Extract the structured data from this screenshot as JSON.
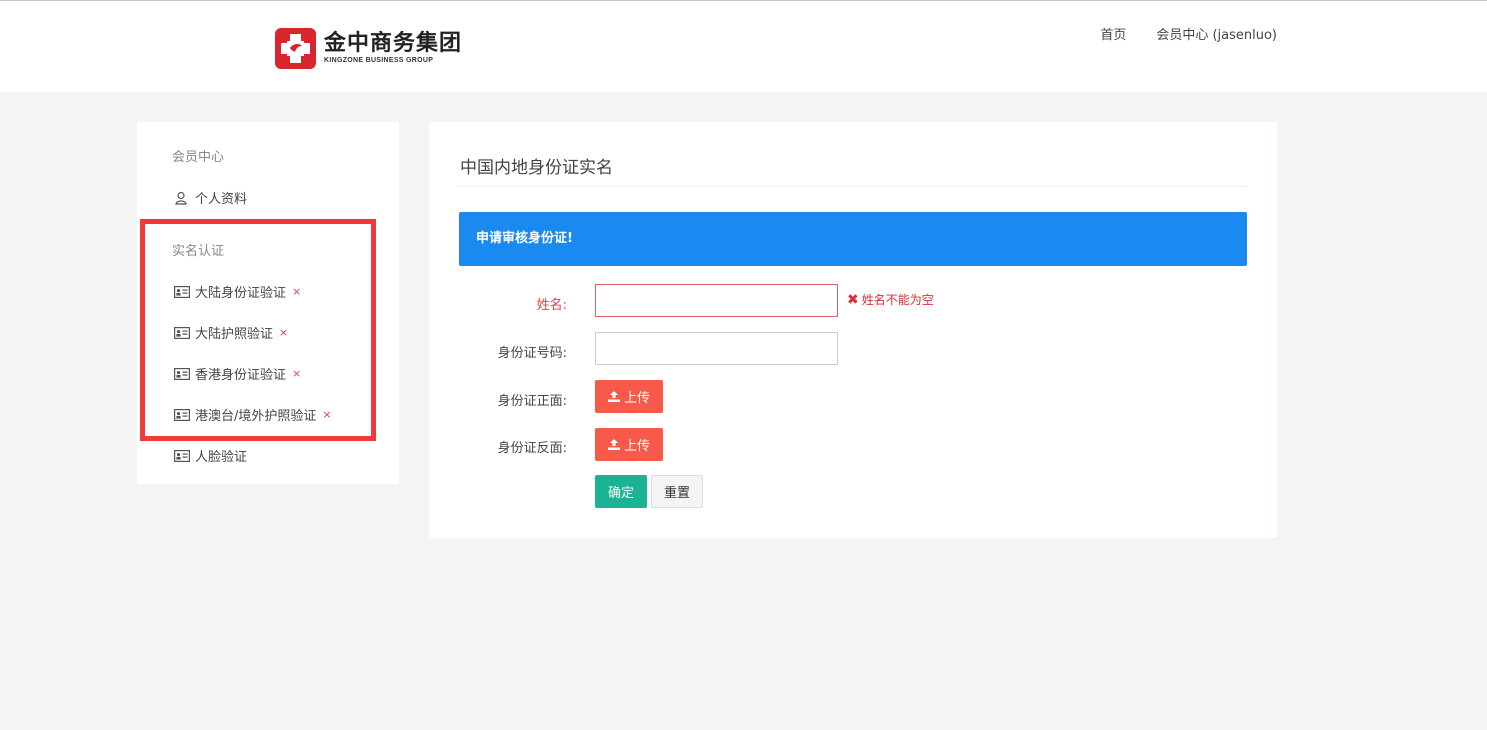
{
  "header": {
    "logo_cn": "金中商务集团",
    "logo_en": "KINGZONE BUSINESS GROUP",
    "nav": {
      "home": "首页",
      "member_center": "会员中心 (jasenluo)"
    }
  },
  "sidebar": {
    "heading_member": "会员中心",
    "profile": "个人资料",
    "heading_verify": "实名认证",
    "items": [
      {
        "label": "大陆身份证验证",
        "status": "×"
      },
      {
        "label": "大陆护照验证",
        "status": "×"
      },
      {
        "label": "香港身份证验证",
        "status": "×"
      },
      {
        "label": "港澳台/境外护照验证",
        "status": "×"
      },
      {
        "label": "人脸验证",
        "status": ""
      }
    ]
  },
  "main": {
    "title": "中国内地身份证实名",
    "banner": "申请审核身份证!",
    "form": {
      "name_label": "姓名:",
      "name_value": "",
      "name_error": "姓名不能为空",
      "id_label": "身份证号码:",
      "id_value": "",
      "front_label": "身份证正面:",
      "back_label": "身份证反面:",
      "upload_label": "上传",
      "confirm": "确定",
      "reset": "重置"
    }
  },
  "colors": {
    "brand_red": "#d8262c",
    "banner_blue": "#1a8af0",
    "upload_red": "#f75a4b",
    "confirm_green": "#1bb394",
    "error_red": "#d83030",
    "highlight_red": "#ef3a3a"
  },
  "icons": {
    "logo": "kingzone-logo-icon",
    "user": "user-icon",
    "id_card": "id-card-icon",
    "upload": "upload-icon",
    "error": "error-x-icon"
  }
}
